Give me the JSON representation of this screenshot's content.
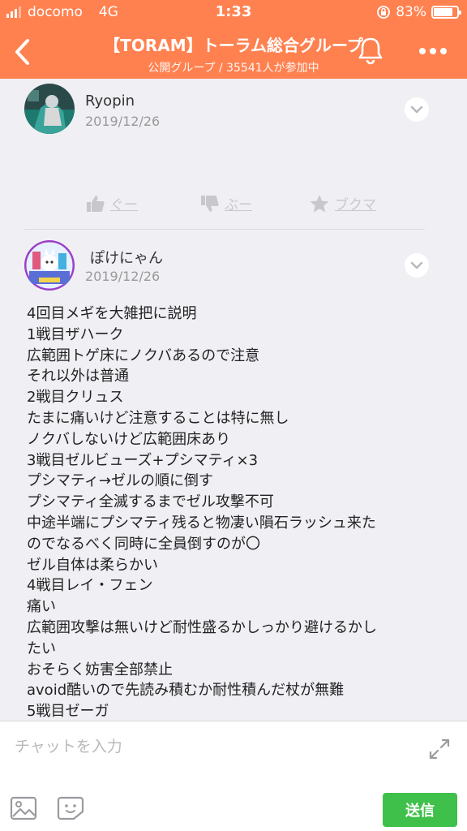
{
  "status_bar": {
    "carrier": "docomo",
    "network": "4G",
    "time": "1:33",
    "battery_text": "83%",
    "battery_level": 0.83
  },
  "header": {
    "title": "【TORAM】トーラム総合グループ",
    "subtitle": "公開グループ / 35541人が参加中",
    "color": "#ff8150"
  },
  "posts": [
    {
      "author": "Ryopin",
      "date": "2019/12/26",
      "reactions": {
        "like": "ぐー",
        "dislike": "ぶー",
        "bookmark": "ブクマ"
      }
    },
    {
      "author": "ぽけにゃん",
      "date": "2019/12/26",
      "lines": [
        "4回目メギを大雑把に説明",
        "1戦目ザハーク",
        "広範囲トゲ床にノクバあるので注意",
        "それ以外は普通",
        "2戦目クリュス",
        "たまに痛いけど注意することは特に無し",
        "ノクバしないけど広範囲床あり",
        "3戦目ゼルビューズ+プシマティ×3",
        "プシマティ→ゼルの順に倒す",
        "プシマティ全滅するまでゼル攻撃不可",
        "中途半端にプシマティ残ると物凄い隕石ラッシュ来た",
        "のでなるべく同時に全員倒すのが〇",
        "ゼル自体は柔らかい",
        "4戦目レイ・フェン",
        "痛い",
        "広範囲攻撃は無いけど耐性盛るかしっかり避けるかし",
        "たい",
        "おそらく妨害全部禁止",
        "avoid酷いので先読み積むか耐性積んだ杖が無難",
        "5戦目ゼーガ"
      ]
    }
  ],
  "footer": {
    "input_placeholder": "チャットを入力",
    "send_label": "送信",
    "send_color": "#3fc04a"
  }
}
